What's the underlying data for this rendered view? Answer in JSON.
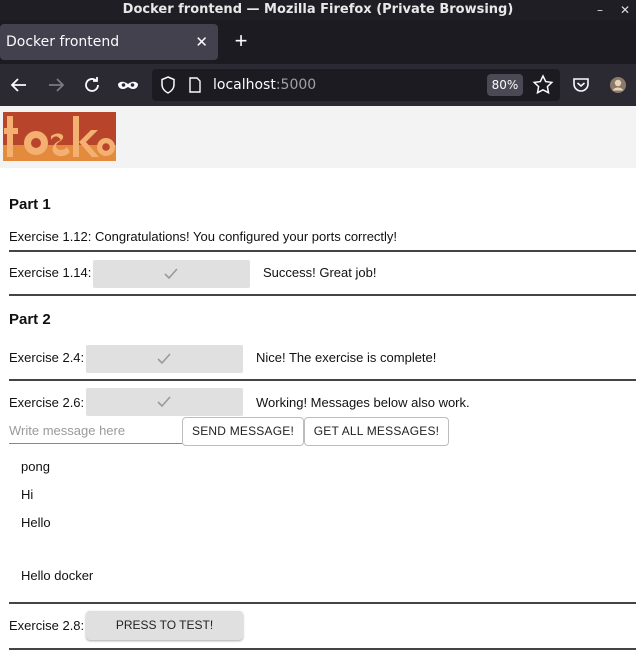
{
  "window": {
    "title": "Docker frontend — Mozilla Firefox (Private Browsing)"
  },
  "tab": {
    "label": "Docker frontend"
  },
  "urlbar": {
    "host": "localhost",
    "port": ":5000",
    "zoom": "80%"
  },
  "page": {
    "part1": {
      "title": "Part 1",
      "ex112": "Exercise 1.12: Congratulations! You configured your ports correctly!",
      "ex114_label": "Exercise 1.14:",
      "ex114_status": "Success! Great job!"
    },
    "part2": {
      "title": "Part 2",
      "ex24_label": "Exercise 2.4:",
      "ex24_status": "Nice! The exercise is complete!",
      "ex26_label": "Exercise 2.6:",
      "ex26_status": "Working! Messages below also work.",
      "message_placeholder": "Write message here",
      "send_button": "SEND MESSAGE!",
      "get_all_button": "GET ALL MESSAGES!",
      "messages": [
        "pong",
        "Hi",
        "Hello",
        "",
        "Hello docker"
      ],
      "ex28_label": "Exercise 2.8:",
      "test_button": "PRESS TO TEST!"
    }
  }
}
